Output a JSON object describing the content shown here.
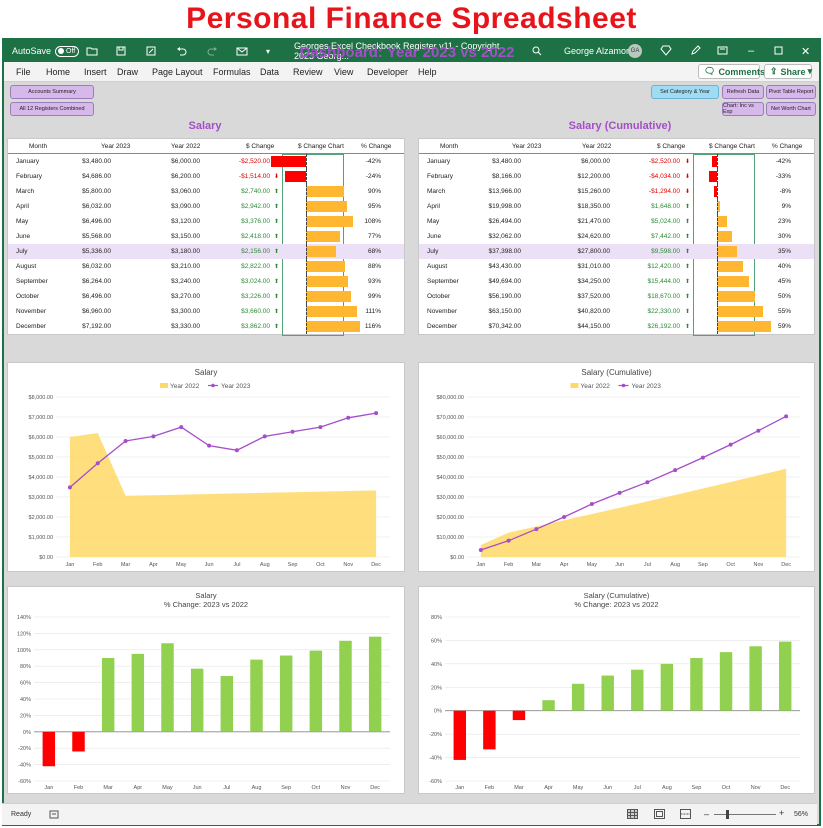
{
  "banner": {
    "title": "Personal Finance Spreadsheet"
  },
  "window": {
    "autosave_label": "AutoSave",
    "autosave_state": "Off",
    "doc_title": "Georges Excel Checkbook Register v11 - Copyright 2023 Georg...",
    "user_name": "George Alzamora",
    "user_initials": "GA"
  },
  "menu": {
    "items": [
      "File",
      "Home",
      "Insert",
      "Draw",
      "Page Layout",
      "Formulas",
      "Data",
      "Review",
      "View",
      "Developer",
      "Help"
    ],
    "comments_label": "Comments",
    "share_label": "Share"
  },
  "macro_buttons": {
    "accounts_summary": "Accounts Summary",
    "all_registers": "All 12 Registers Combined",
    "set_category": "Set Category & Year",
    "refresh": "Refresh Data",
    "pivot": "Pivot Table Report",
    "chart_inc": "Chart: Inc vs Exp",
    "net_worth": "Net Worth Chart"
  },
  "dashboard": {
    "title": "Dashboard: Year 2023 vs 2022"
  },
  "salary_table": {
    "title": "Salary",
    "headers": [
      "Month",
      "Year  2023",
      "Year  2022",
      "$ Change",
      "$ Change Chart",
      "% Change"
    ],
    "rows": [
      {
        "month": "January",
        "y2023": "$3,480.00",
        "y2022": "$6,000.00",
        "change": "-$2,520.00",
        "pct": "-42%",
        "val": -2520
      },
      {
        "month": "February",
        "y2023": "$4,686.00",
        "y2022": "$6,200.00",
        "change": "-$1,514.00",
        "pct": "-24%",
        "val": -1514
      },
      {
        "month": "March",
        "y2023": "$5,800.00",
        "y2022": "$3,060.00",
        "change": "$2,740.00",
        "pct": "90%",
        "val": 2740
      },
      {
        "month": "April",
        "y2023": "$6,032.00",
        "y2022": "$3,090.00",
        "change": "$2,942.00",
        "pct": "95%",
        "val": 2942
      },
      {
        "month": "May",
        "y2023": "$6,496.00",
        "y2022": "$3,120.00",
        "change": "$3,376.00",
        "pct": "108%",
        "val": 3376
      },
      {
        "month": "June",
        "y2023": "$5,568.00",
        "y2022": "$3,150.00",
        "change": "$2,418.00",
        "pct": "77%",
        "val": 2418
      },
      {
        "month": "July",
        "y2023": "$5,336.00",
        "y2022": "$3,180.00",
        "change": "$2,156.00",
        "pct": "68%",
        "val": 2156
      },
      {
        "month": "August",
        "y2023": "$6,032.00",
        "y2022": "$3,210.00",
        "change": "$2,822.00",
        "pct": "88%",
        "val": 2822
      },
      {
        "month": "September",
        "y2023": "$6,264.00",
        "y2022": "$3,240.00",
        "change": "$3,024.00",
        "pct": "93%",
        "val": 3024
      },
      {
        "month": "October",
        "y2023": "$6,496.00",
        "y2022": "$3,270.00",
        "change": "$3,226.00",
        "pct": "99%",
        "val": 3226
      },
      {
        "month": "November",
        "y2023": "$6,960.00",
        "y2022": "$3,300.00",
        "change": "$3,660.00",
        "pct": "111%",
        "val": 3660
      },
      {
        "month": "December",
        "y2023": "$7,192.00",
        "y2022": "$3,330.00",
        "change": "$3,862.00",
        "pct": "116%",
        "val": 3862
      }
    ]
  },
  "cumulative_table": {
    "title": "Salary (Cumulative)",
    "headers": [
      "Month",
      "Year  2023",
      "Year  2022",
      "$ Change",
      "$ Change Chart",
      "% Change"
    ],
    "rows": [
      {
        "month": "January",
        "y2023": "$3,480.00",
        "y2022": "$6,000.00",
        "change": "-$2,520.00",
        "pct": "-42%",
        "val": -2520
      },
      {
        "month": "February",
        "y2023": "$8,166.00",
        "y2022": "$12,200.00",
        "change": "-$4,034.00",
        "pct": "-33%",
        "val": -4034
      },
      {
        "month": "March",
        "y2023": "$13,966.00",
        "y2022": "$15,260.00",
        "change": "-$1,294.00",
        "pct": "-8%",
        "val": -1294
      },
      {
        "month": "April",
        "y2023": "$19,998.00",
        "y2022": "$18,350.00",
        "change": "$1,648.00",
        "pct": "9%",
        "val": 1648
      },
      {
        "month": "May",
        "y2023": "$26,494.00",
        "y2022": "$21,470.00",
        "change": "$5,024.00",
        "pct": "23%",
        "val": 5024
      },
      {
        "month": "June",
        "y2023": "$32,062.00",
        "y2022": "$24,620.00",
        "change": "$7,442.00",
        "pct": "30%",
        "val": 7442
      },
      {
        "month": "July",
        "y2023": "$37,398.00",
        "y2022": "$27,800.00",
        "change": "$9,598.00",
        "pct": "35%",
        "val": 9598
      },
      {
        "month": "August",
        "y2023": "$43,430.00",
        "y2022": "$31,010.00",
        "change": "$12,420.00",
        "pct": "40%",
        "val": 12420
      },
      {
        "month": "September",
        "y2023": "$49,694.00",
        "y2022": "$34,250.00",
        "change": "$15,444.00",
        "pct": "45%",
        "val": 15444
      },
      {
        "month": "October",
        "y2023": "$56,190.00",
        "y2022": "$37,520.00",
        "change": "$18,670.00",
        "pct": "50%",
        "val": 18670
      },
      {
        "month": "November",
        "y2023": "$63,150.00",
        "y2022": "$40,820.00",
        "change": "$22,330.00",
        "pct": "55%",
        "val": 22330
      },
      {
        "month": "December",
        "y2023": "$70,342.00",
        "y2022": "$44,150.00",
        "change": "$26,192.00",
        "pct": "59%",
        "val": 26192
      }
    ]
  },
  "colors": {
    "excel_green": "#1e7145",
    "accent_purple": "#a64dc9",
    "negative": "#ff0000",
    "positive_bar": "#92d050",
    "area": "#ffd966",
    "line": "#a64dc9",
    "change_bar": "#ffb732"
  },
  "status": {
    "ready": "Ready",
    "zoom": "56%"
  },
  "chart_data": [
    {
      "type": "line",
      "title": "Salary",
      "categories": [
        "Jan",
        "Feb",
        "Mar",
        "Apr",
        "May",
        "Jun",
        "Jul",
        "Aug",
        "Sep",
        "Oct",
        "Nov",
        "Dec"
      ],
      "series": [
        {
          "name": "Year  2022",
          "kind": "area",
          "values": [
            6000,
            6200,
            3060,
            3090,
            3120,
            3150,
            3180,
            3210,
            3240,
            3270,
            3300,
            3330
          ]
        },
        {
          "name": "Year  2023",
          "kind": "line",
          "values": [
            3480,
            4686,
            5800,
            6032,
            6496,
            5568,
            5336,
            6032,
            6264,
            6496,
            6960,
            7192
          ]
        }
      ],
      "ylim": [
        0,
        8000
      ],
      "yticks": [
        "$0.00",
        "$1,000.00",
        "$2,000.00",
        "$3,000.00",
        "$4,000.00",
        "$5,000.00",
        "$6,000.00",
        "$7,000.00",
        "$8,000.00"
      ],
      "legend": "top"
    },
    {
      "type": "line",
      "title": "Salary (Cumulative)",
      "categories": [
        "Jan",
        "Feb",
        "Mar",
        "Apr",
        "May",
        "Jun",
        "Jul",
        "Aug",
        "Sep",
        "Oct",
        "Nov",
        "Dec"
      ],
      "series": [
        {
          "name": "Year  2022",
          "kind": "area",
          "values": [
            6000,
            12200,
            15260,
            18350,
            21470,
            24620,
            27800,
            31010,
            34250,
            37520,
            40820,
            44150
          ]
        },
        {
          "name": "Year  2023",
          "kind": "line",
          "values": [
            3480,
            8166,
            13966,
            19998,
            26494,
            32062,
            37398,
            43430,
            49694,
            56190,
            63150,
            70342
          ]
        }
      ],
      "ylim": [
        0,
        80000
      ],
      "yticks": [
        "$0.00",
        "$10,000.00",
        "$20,000.00",
        "$30,000.00",
        "$40,000.00",
        "$50,000.00",
        "$60,000.00",
        "$70,000.00",
        "$80,000.00"
      ],
      "legend": "top"
    },
    {
      "type": "bar",
      "title": "Salary",
      "subtitle": "% Change: 2023 vs 2022",
      "categories": [
        "Jan",
        "Feb",
        "Mar",
        "Apr",
        "May",
        "Jun",
        "Jul",
        "Aug",
        "Sep",
        "Oct",
        "Nov",
        "Dec"
      ],
      "values": [
        -42,
        -24,
        90,
        95,
        108,
        77,
        68,
        88,
        93,
        99,
        111,
        116
      ],
      "ylim": [
        -60,
        140
      ],
      "yticks": [
        "-60%",
        "-40%",
        "-20%",
        "0%",
        "20%",
        "40%",
        "60%",
        "80%",
        "100%",
        "120%",
        "140%"
      ]
    },
    {
      "type": "bar",
      "title": "Salary (Cumulative)",
      "subtitle": "% Change: 2023 vs 2022",
      "categories": [
        "Jan",
        "Feb",
        "Mar",
        "Apr",
        "May",
        "Jun",
        "Jul",
        "Aug",
        "Sep",
        "Oct",
        "Nov",
        "Dec"
      ],
      "values": [
        -42,
        -33,
        -8,
        9,
        23,
        30,
        35,
        40,
        45,
        50,
        55,
        59
      ],
      "ylim": [
        -60,
        80
      ],
      "yticks": [
        "-60%",
        "-40%",
        "-20%",
        "0%",
        "20%",
        "40%",
        "60%",
        "80%"
      ]
    }
  ]
}
